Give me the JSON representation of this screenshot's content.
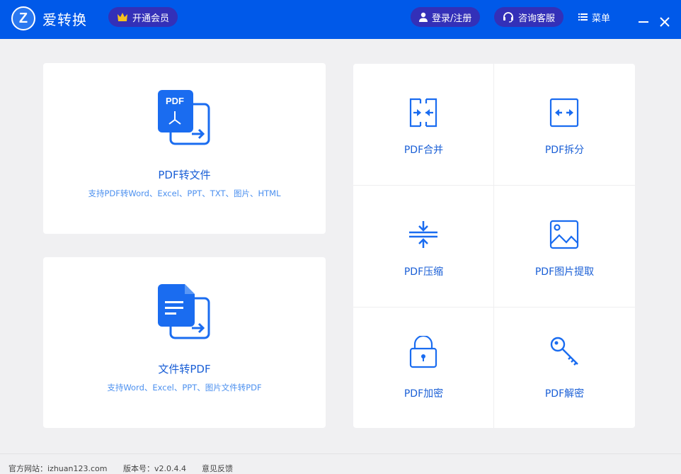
{
  "header": {
    "logo_letter": "Z",
    "app_name": "爱转换",
    "vip": "开通会员",
    "login": "登录/注册",
    "service": "咨询客服",
    "menu": "菜单"
  },
  "cards": [
    {
      "title": "PDF转文件",
      "subtitle": "支持PDF转Word、Excel、PPT、TXT、图片、HTML",
      "icon_text": "PDF"
    },
    {
      "title": "文件转PDF",
      "subtitle": "支持Word、Excel、PPT、图片文件转PDF"
    }
  ],
  "tools": [
    {
      "label": "PDF合并",
      "icon": "merge-icon"
    },
    {
      "label": "PDF拆分",
      "icon": "split-icon"
    },
    {
      "label": "PDF压缩",
      "icon": "compress-icon"
    },
    {
      "label": "PDF图片提取",
      "icon": "image-icon"
    },
    {
      "label": "PDF加密",
      "icon": "lock-icon"
    },
    {
      "label": "PDF解密",
      "icon": "key-icon"
    }
  ],
  "footer": {
    "website": "官方网站：izhuan123.com",
    "version": "版本号：v2.0.4.4",
    "feedback": "意见反馈"
  },
  "colors": {
    "header": "#0059e9",
    "accent": "#1a6cf0"
  }
}
